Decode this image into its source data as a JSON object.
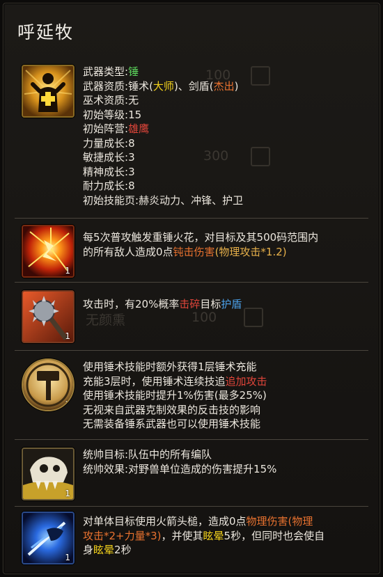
{
  "hero_name": "呼延牧",
  "stats": {
    "weapon_type_label": "武器类型:",
    "weapon_type": "锤",
    "weapon_aptitude_label": "武器资质:",
    "weapon_aptitude_1": "锤术(",
    "weapon_aptitude_1_grade": "大师",
    "weapon_aptitude_1_end": ")、剑盾(",
    "weapon_aptitude_2_grade": "杰出",
    "weapon_aptitude_2_end": ")",
    "magic_aptitude_label": "巫术资质:",
    "magic_aptitude": "无",
    "initial_level_label": "初始等级:",
    "initial_level": "15",
    "initial_camp_label": "初始阵营:",
    "initial_camp": "雄鹰",
    "str_growth_label": "力量成长:",
    "str_growth": "8",
    "agi_growth_label": "敏捷成长:",
    "agi_growth": "3",
    "spi_growth_label": "精神成长:",
    "spi_growth": "3",
    "end_growth_label": "耐力成长:",
    "end_growth": "8",
    "skill_page_label": "初始技能页:",
    "skill_pages": "赫炎动力、冲锋、护卫"
  },
  "skills": [
    {
      "level": "1",
      "line1_a": "每5次普攻触发重锤火花，对目标及其500码范围内",
      "line2_a": "的所有敌人造成0点",
      "line2_b": "钝击伤害",
      "line2_c": "(物理攻击*1.2)"
    },
    {
      "level": "1",
      "line1_a": "攻击时，有20%概率",
      "line1_b": "击碎",
      "line1_c": "目标",
      "line1_d": "护盾"
    },
    {
      "level": "1",
      "line1": "使用锤术技能时额外获得1层锤术充能",
      "line2_a": "充能3层时，使用锤术连续技追",
      "line2_b": "追加攻击",
      "line3": "使用锤术技能时提升1%伤害(最多25%)",
      "line4": "无视来自武器克制效果的反击技的影响",
      "line5": "无需装备锤系武器也可以使用锤术技能"
    },
    {
      "level": "1",
      "line1": "统帅目标:队伍中的所有编队",
      "line2": "统帅效果:对野兽单位造成的伤害提升15%"
    },
    {
      "level": "1",
      "line1_a": "对单体目标使用火箭头槌，造成0点",
      "line1_b": "物理伤害(物理",
      "line2_a": "攻击*2+力量*3)",
      "line2_b": "，并使其",
      "line2_c": "眩晕",
      "line2_d": "5秒，但同时也会使自",
      "line3_a": "身",
      "line3_b": "眩晕",
      "line3_c": "2秒"
    }
  ],
  "background_ghost": {
    "num1": "100",
    "num2": "300",
    "num3": "100",
    "ghost_name": "无颜熏"
  },
  "colors": {
    "green": "#5bd35b",
    "yellow": "#f3d21c",
    "red": "#e0453a",
    "orange": "#e9722f",
    "blue": "#4ba0e8"
  }
}
